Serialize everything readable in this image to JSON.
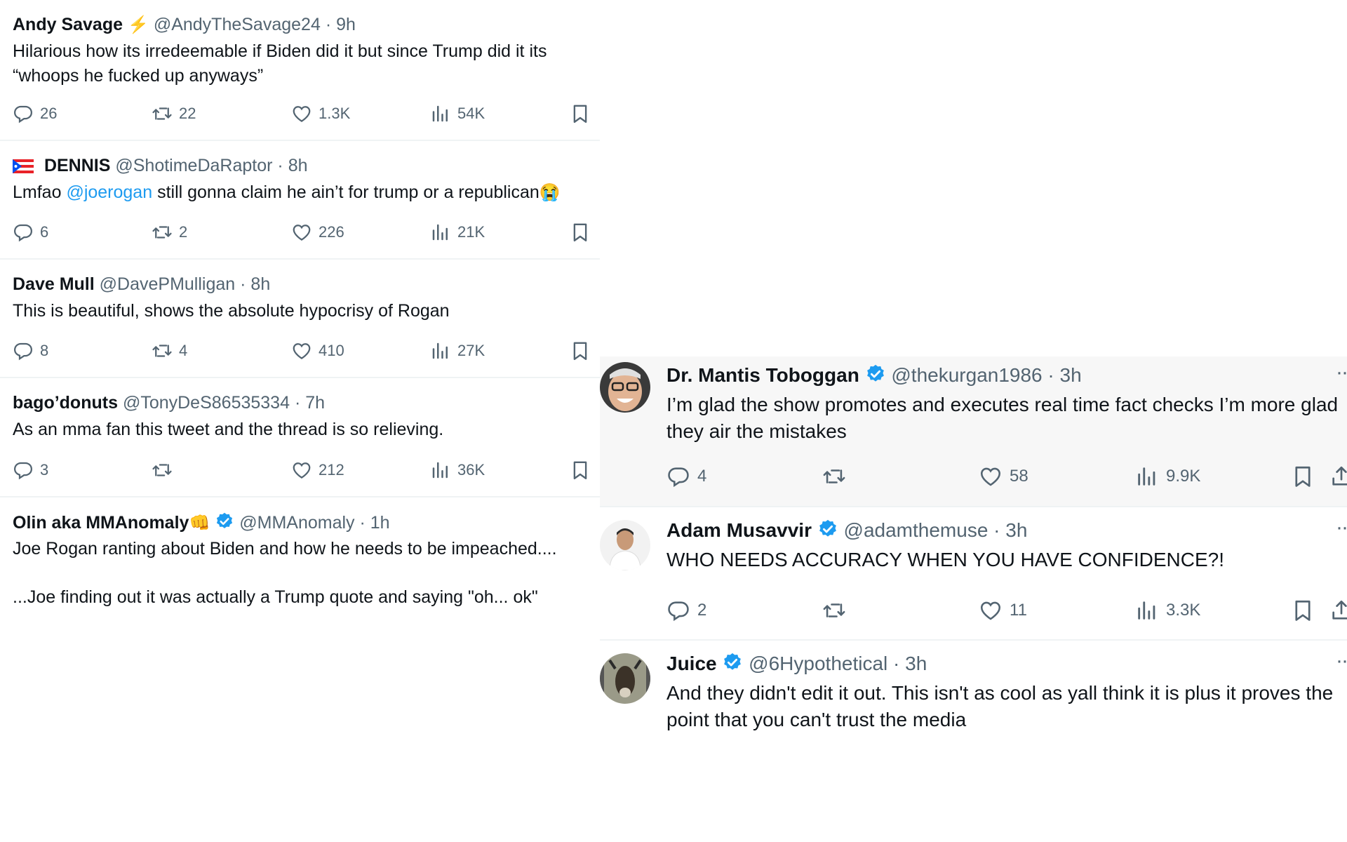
{
  "left_tweets": [
    {
      "name": "Andy Savage",
      "name_emoji": "⚡",
      "handle": "@AndyTheSavage24",
      "sep": "·",
      "time": "9h",
      "text": "Hilarious how its irredeemable if Biden did it but since Trump did it its “whoops he fucked up anyways”",
      "replies": "26",
      "reposts": "22",
      "likes": "1.3K",
      "views": "54K"
    },
    {
      "name": "DENNIS",
      "handle": "@ShotimeDaRaptor",
      "sep": "·",
      "time": "8h",
      "text_before": "Lmfao ",
      "mention": "@joerogan",
      "text_after": " still gonna claim he ain’t for trump or a republican",
      "text_emoji": "😭",
      "replies": "6",
      "reposts": "2",
      "likes": "226",
      "views": "21K"
    },
    {
      "name": "Dave Mull",
      "handle": "@DavePMulligan",
      "sep": "·",
      "time": "8h",
      "text": "This is beautiful, shows the absolute hypocrisy of Rogan",
      "replies": "8",
      "reposts": "4",
      "likes": "410",
      "views": "27K"
    },
    {
      "name": "bago’donuts",
      "handle": "@TonyDeS86535334",
      "sep": "·",
      "time": "7h",
      "text": "As an mma fan this tweet and the thread is so relieving.",
      "replies": "3",
      "reposts": "",
      "likes": "212",
      "views": "36K"
    },
    {
      "name": "Olin aka MMAnomaly",
      "name_emoji": "👊",
      "handle": "@MMAnomaly",
      "sep": "·",
      "time": "1h",
      "text_line1": "Joe Rogan ranting about Biden and how he needs to be impeached....",
      "text_line2": "...Joe finding out it was actually a Trump quote and saying \"oh... ok\""
    }
  ],
  "right_tweets": [
    {
      "name": "Dr. Mantis Toboggan",
      "handle": "@thekurgan1986",
      "sep": "·",
      "time": "3h",
      "text": "I’m glad the show promotes and executes real time fact checks  I’m more glad they air the mistakes",
      "replies": "4",
      "reposts": "",
      "likes": "58",
      "views": "9.9K",
      "more": "··"
    },
    {
      "name": "Adam Musavvir",
      "handle": "@adamthemuse",
      "sep": "·",
      "time": "3h",
      "text": "WHO NEEDS ACCURACY WHEN YOU HAVE CONFIDENCE?!",
      "replies": "2",
      "reposts": "",
      "likes": "11",
      "views": "3.3K",
      "more": "··"
    },
    {
      "name": "Juice",
      "handle": "@6Hypothetical",
      "sep": "·",
      "time": "3h",
      "text": "And they didn't edit it out. This isn't as cool as yall think it is plus it proves the point that you can't trust the media",
      "more": "··"
    }
  ],
  "colors": {
    "text": "#0f1419",
    "muted": "#536471",
    "accent": "#1d9bf0",
    "border": "#eff3f4"
  },
  "icons": [
    "reply-icon",
    "repost-icon",
    "like-icon",
    "views-icon",
    "bookmark-icon",
    "share-icon",
    "verified-badge-icon",
    "more-icon"
  ]
}
